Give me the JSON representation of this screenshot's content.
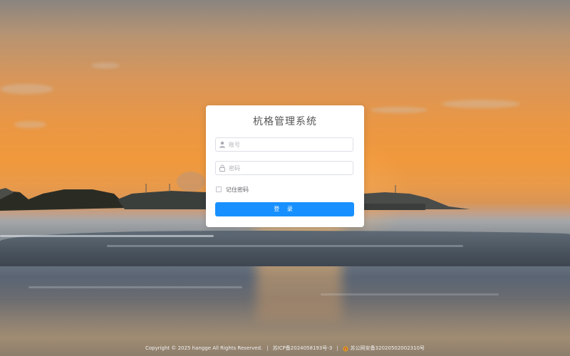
{
  "login": {
    "title": "杭格管理系统",
    "account_placeholder": "账号",
    "password_placeholder": "密码",
    "remember_label": "记住密码",
    "submit_label": "登 录"
  },
  "footer": {
    "copyright": "Copyright © 2025 hangge All Rights Reserved.",
    "separator": "|",
    "icp": "苏ICP备2024058193号-3",
    "police": "苏公网安备32020502002310号"
  },
  "icons": {
    "account": "user-icon",
    "password": "lock-icon",
    "police": "police-badge-icon"
  },
  "colors": {
    "primary": "#1890ff",
    "card": "#ffffff",
    "title": "#555555"
  }
}
